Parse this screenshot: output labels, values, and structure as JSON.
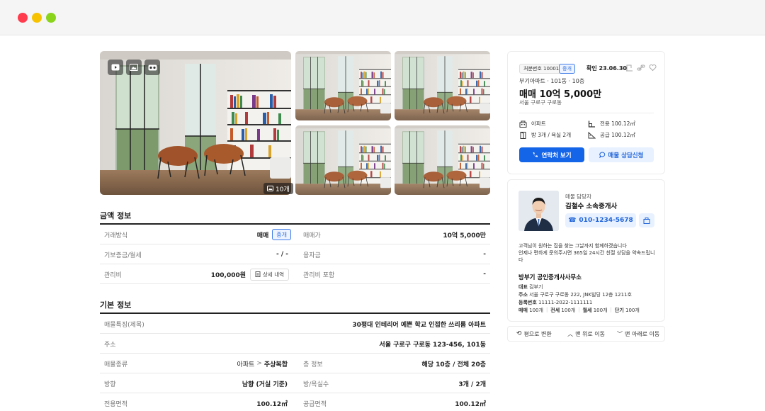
{
  "gallery": {
    "photo_count": "10개",
    "media_buttons": [
      "video-icon",
      "image-icon",
      "vr-icon"
    ]
  },
  "price_section": {
    "title": "금액 정보",
    "rows": [
      {
        "l1": "거래방식",
        "v1": "매매",
        "badge": "중개",
        "l2": "매매가",
        "v2": "10억 5,000만"
      },
      {
        "l1": "기보증금/월세",
        "v1": "- / -",
        "l2": "융자금",
        "v2": "-"
      },
      {
        "l1": "관리비",
        "v1": "100,000원",
        "btn": "상세 내역",
        "l2": "관리비 포함",
        "v2": "-"
      }
    ]
  },
  "basic_section": {
    "title": "기본 정보",
    "feature_label": "매물특징(제목)",
    "feature_value": "30평대 인테리어 예쁜 학교 인접한 쓰리룸 아파트",
    "address_label": "주소",
    "address_value": "서울 구로구 구로동 123-456, 101동",
    "type_label": "매물종류",
    "type_value_a": "아파트",
    "type_value_b": "주상복합",
    "floor_label": "층 정보",
    "floor_value": "해당 10층 / 전체 20층",
    "direction_label": "방향",
    "direction_value": "남향 (거실 기준)",
    "rooms_label": "방/욕실수",
    "rooms_value": "3개 / 2개",
    "area_label": "전용면적",
    "area_value": "100.12㎡",
    "supply_label": "공급면적",
    "supply_value": "100.12㎡"
  },
  "summary_card": {
    "listing_no": "처분번호 10001",
    "deal_badge": "중개",
    "confirm_date": "확인 23.06.30",
    "complex": "부기아파트 · 101동 · 10층",
    "price": "매매 10억 5,000만",
    "region": "서울 구로구 구로동",
    "specs": {
      "type": "아파트",
      "rooms": "방 3개 / 욕실 2개",
      "exclusive": "전용 100.12㎡",
      "supply": "공급 100.12㎡"
    },
    "contact_button": "연락처 보기",
    "consult_button": "매물 상담신청"
  },
  "agent_card": {
    "role": "매물 담당자",
    "name": "김철수 소속중개사",
    "phone": "010-1234-5678",
    "message": "고객님이 원하는 집을 찾는 그날까지 함께하겠습니다\n언제나 편하게 문의주시면 365일 24시간 친절 상담을 약속드립니다",
    "office_name": "방부기 공인중개사사무소",
    "rep_label": "대표",
    "rep_value": "김부기",
    "addr_label": "주소",
    "addr_value": "서울 구로구 구로동 222, JNK빌딩 12층 1211호",
    "reg_label": "등록번호",
    "reg_value": "11111-2022-1111111",
    "counts": [
      {
        "label": "매매",
        "value": "100개"
      },
      {
        "label": "전세",
        "value": "100개"
      },
      {
        "label": "월세",
        "value": "100개"
      },
      {
        "label": "단기",
        "value": "100개"
      }
    ]
  },
  "bottom_bar": {
    "convert": "평으로 변환",
    "top": "맨 위로 이동",
    "bottom": "맨 아래로 이동"
  }
}
